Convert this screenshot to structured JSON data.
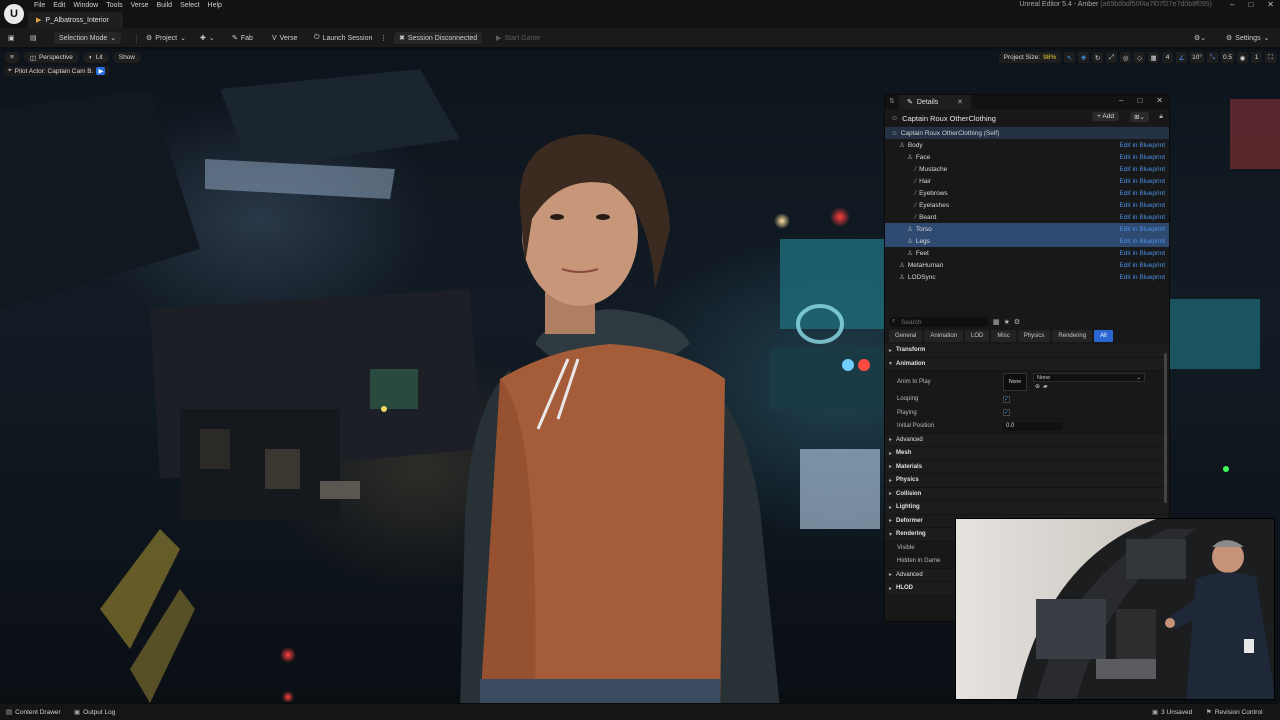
{
  "menu": [
    "File",
    "Edit",
    "Window",
    "Tools",
    "Verse",
    "Build",
    "Select",
    "Help"
  ],
  "level_tab": "P_Albatross_Interior",
  "app_title": "Unreal Editor 5.4 - Amber",
  "app_hash": "(a69b8bdf50f4a7f07f27e7d0b8f095)",
  "toolbar": {
    "mode": "Selection Mode",
    "project": "Project",
    "fab": "Fab",
    "verse": "Verse",
    "launch_session": "Launch Session",
    "session_status": "Session Disconnected",
    "start_game": "Start Game",
    "settings": "Settings"
  },
  "viewport": {
    "perspective": "Perspective",
    "lit": "Lit",
    "show": "Show",
    "pilot": "Pilot Actor: Captain Cam B.",
    "project_size_label": "Project Size:",
    "project_size_value": "98%",
    "grid_value": "10",
    "angle_value": "10°",
    "scale_value": "0.5",
    "camera_speed": "1",
    "layer_count": "4"
  },
  "details": {
    "tab_label": "Details",
    "actor_name": "Captain Roux OtherClothing",
    "add_label": "Add",
    "self_label": "Captain Roux OtherClothing (Self)",
    "edit_link": "Edit in Blueprint",
    "components": [
      {
        "name": "Body",
        "indent": 1,
        "selected": false
      },
      {
        "name": "Face",
        "indent": 2,
        "selected": false
      },
      {
        "name": "Mustache",
        "indent": 3,
        "selected": false
      },
      {
        "name": "Hair",
        "indent": 3,
        "selected": false
      },
      {
        "name": "Eyebrows",
        "indent": 3,
        "selected": false
      },
      {
        "name": "Eyelashes",
        "indent": 3,
        "selected": false
      },
      {
        "name": "Beard",
        "indent": 3,
        "selected": false
      },
      {
        "name": "Torso",
        "indent": 2,
        "selected": true
      },
      {
        "name": "Legs",
        "indent": 2,
        "selected": true
      },
      {
        "name": "Feet",
        "indent": 2,
        "selected": false
      },
      {
        "name": "MetaHuman",
        "indent": 1,
        "selected": false
      },
      {
        "name": "LODSync",
        "indent": 1,
        "selected": false
      }
    ],
    "search_placeholder": "Search",
    "filters": [
      "General",
      "Animation",
      "LOD",
      "Misc",
      "Physics",
      "Rendering",
      "All"
    ],
    "active_filter": "All",
    "categories": {
      "transform": "Transform",
      "animation": "Animation",
      "anim_to_play": "Anim to Play",
      "anim_none_thumb": "None",
      "anim_dropdown": "None",
      "looping": "Looping",
      "playing": "Playing",
      "initial_position": "Initial Position",
      "initial_position_value": "0.0",
      "advanced": "Advanced",
      "mesh": "Mesh",
      "materials": "Materials",
      "physics": "Physics",
      "collision": "Collision",
      "lighting": "Lighting",
      "deformer": "Deformer",
      "rendering": "Rendering",
      "visible": "Visible",
      "hidden_in_game": "Hidden in Game",
      "advanced2": "Advanced",
      "hlod": "HLOD"
    }
  },
  "statusbar": {
    "content_drawer": "Content Drawer",
    "output_log": "Output Log",
    "unsaved": "3 Unsaved",
    "revision_control": "Revision Control"
  },
  "colors": {
    "accent_blue": "#2a66d4",
    "selection": "#2f4a70",
    "link": "#4a8fe8"
  }
}
